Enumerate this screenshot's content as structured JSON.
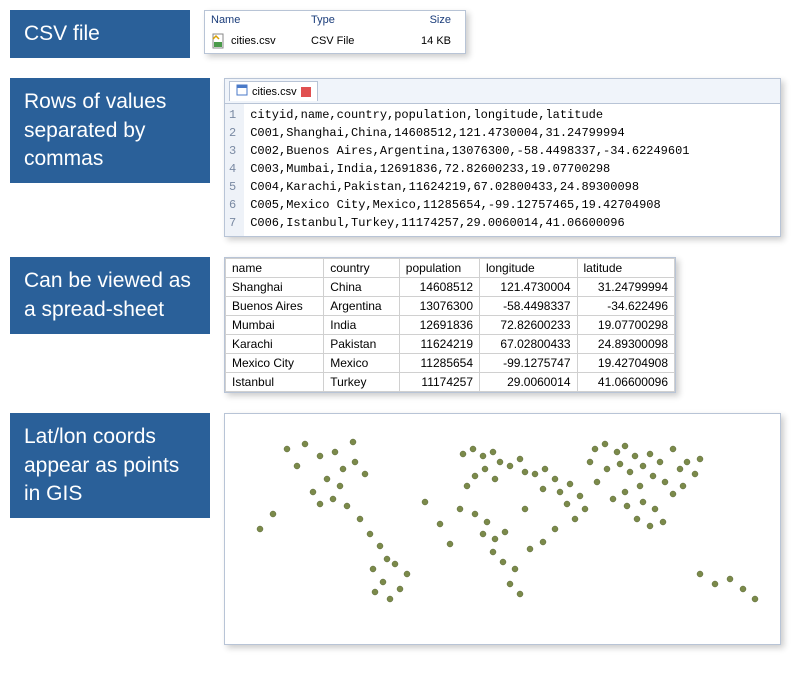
{
  "labels": {
    "csv": "CSV file",
    "rows": "Rows of values separated by commas",
    "spread": "Can be viewed as a spread-sheet",
    "gis": "Lat/lon coords appear as points in GIS"
  },
  "file": {
    "hdr_name": "Name",
    "hdr_type": "Type",
    "hdr_size": "Size",
    "name": "cities.csv",
    "type": "CSV File",
    "size": "14 KB"
  },
  "editor": {
    "tab": "cities.csv",
    "lines": {
      "l1": "cityid,name,country,population,longitude,latitude",
      "l2": "C001,Shanghai,China,14608512,121.4730004,31.24799994",
      "l3": "C002,Buenos Aires,Argentina,13076300,-58.4498337,-34.62249601",
      "l4": "C003,Mumbai,India,12691836,72.82600233,19.07700298",
      "l5": "C004,Karachi,Pakistan,11624219,67.02800433,24.89300098",
      "l6": "C005,Mexico City,Mexico,11285654,-99.12757465,19.42704908",
      "l7": "C006,Istanbul,Turkey,11174257,29.0060014,41.06600096"
    },
    "nums": {
      "n1": "1",
      "n2": "2",
      "n3": "3",
      "n4": "4",
      "n5": "5",
      "n6": "6",
      "n7": "7"
    }
  },
  "sheet": {
    "hdr": {
      "name": "name",
      "country": "country",
      "pop": "population",
      "lon": "longitude",
      "lat": "latitude"
    },
    "rows": {
      "r0": {
        "name": "Shanghai",
        "country": "China",
        "pop": "14608512",
        "lon": "121.4730004",
        "lat": "31.24799994"
      },
      "r1": {
        "name": "Buenos Aires",
        "country": "Argentina",
        "pop": "13076300",
        "lon": "-58.4498337",
        "lat": "-34.622496"
      },
      "r2": {
        "name": "Mumbai",
        "country": "India",
        "pop": "12691836",
        "lon": "72.82600233",
        "lat": "19.07700298"
      },
      "r3": {
        "name": "Karachi",
        "country": "Pakistan",
        "pop": "11624219",
        "lon": "67.02800433",
        "lat": "24.89300098"
      },
      "r4": {
        "name": "Mexico City",
        "country": "Mexico",
        "pop": "11285654",
        "lon": "-99.1275747",
        "lat": "19.42704908"
      },
      "r5": {
        "name": "Istanbul",
        "country": "Turkey",
        "pop": "11174257",
        "lon": "29.0060014",
        "lat": "41.06600096"
      }
    }
  }
}
